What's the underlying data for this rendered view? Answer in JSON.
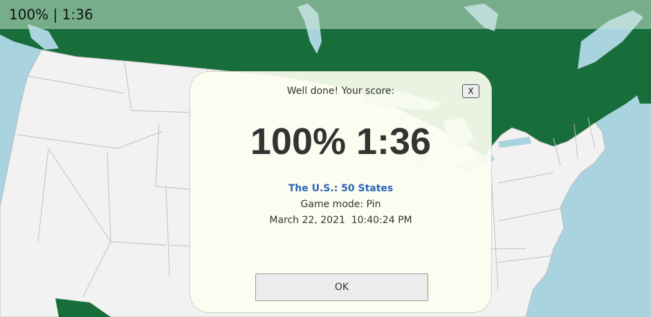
{
  "status_bar": {
    "score": "100%",
    "separator": "|",
    "time": "1:36"
  },
  "dialog": {
    "heading": "Well done! Your score:",
    "close_label": "X",
    "big_score": "100% 1:36",
    "quiz_name": "The U.S.: 50 States",
    "game_mode": "Game mode: Pin",
    "timestamp": "March 22, 2021  10:40:24 PM",
    "ok_label": "OK"
  },
  "colors": {
    "water": "#a9d3df",
    "land_us": "#f2f2f2",
    "land_neighbors": "#186e3a",
    "state_borders": "#bfbfbf",
    "dialog_background": "#fdfdf0",
    "quiz_name_link": "#2a66b8"
  }
}
